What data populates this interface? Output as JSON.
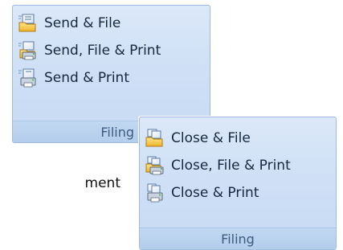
{
  "groups": [
    {
      "name": "Filing",
      "items": [
        {
          "label": "Send & File",
          "icon": "send-file-icon"
        },
        {
          "label": "Send, File & Print",
          "icon": "send-file-print-icon"
        },
        {
          "label": "Send & Print",
          "icon": "send-print-icon"
        }
      ]
    },
    {
      "name": "Filing",
      "items": [
        {
          "label": "Close & File",
          "icon": "close-file-icon"
        },
        {
          "label": "Close, File & Print",
          "icon": "close-file-print-icon"
        },
        {
          "label": "Close & Print",
          "icon": "close-print-icon"
        }
      ]
    }
  ],
  "background_text": "ment",
  "colors": {
    "ribbon_bg": "#cfe0f6",
    "ribbon_border": "#9fbbe0",
    "text": "#15283f",
    "group_label_text": "#3d5a80"
  }
}
